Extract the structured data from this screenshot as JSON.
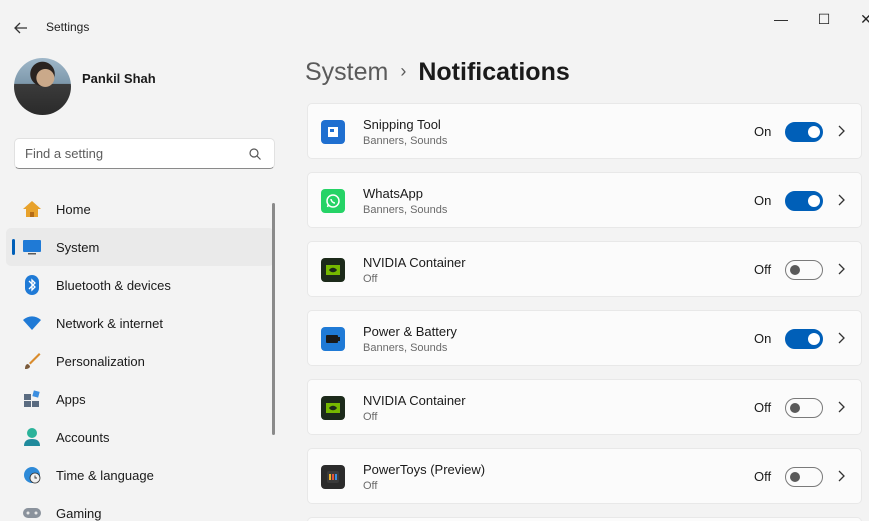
{
  "window": {
    "title": "Settings",
    "back_icon": "arrow-left-icon",
    "minimize_glyph": "—",
    "maximize_glyph": "☐",
    "close_glyph": "✕"
  },
  "profile": {
    "name": "Pankil Shah"
  },
  "search": {
    "placeholder": "Find a setting"
  },
  "sidebar": {
    "items": [
      {
        "label": "Home",
        "icon": "home-icon",
        "active": false
      },
      {
        "label": "System",
        "icon": "system-monitor-icon",
        "active": true
      },
      {
        "label": "Bluetooth & devices",
        "icon": "bluetooth-icon",
        "active": false
      },
      {
        "label": "Network & internet",
        "icon": "wifi-icon",
        "active": false
      },
      {
        "label": "Personalization",
        "icon": "brush-icon",
        "active": false
      },
      {
        "label": "Apps",
        "icon": "apps-icon",
        "active": false
      },
      {
        "label": "Accounts",
        "icon": "accounts-icon",
        "active": false
      },
      {
        "label": "Time & language",
        "icon": "globe-clock-icon",
        "active": false
      },
      {
        "label": "Gaming",
        "icon": "gamepad-icon",
        "active": false
      }
    ]
  },
  "header": {
    "parent": "System",
    "separator": "›",
    "current": "Notifications"
  },
  "apps": [
    {
      "name": "Snipping Tool",
      "detail": "Banners, Sounds",
      "state": "On",
      "enabled": true,
      "icon": "snipping-tool-icon"
    },
    {
      "name": "WhatsApp",
      "detail": "Banners, Sounds",
      "state": "On",
      "enabled": true,
      "icon": "whatsapp-icon"
    },
    {
      "name": "NVIDIA Container",
      "detail": "Off",
      "state": "Off",
      "enabled": false,
      "icon": "nvidia-icon"
    },
    {
      "name": "Power & Battery",
      "detail": "Banners, Sounds",
      "state": "On",
      "enabled": true,
      "icon": "battery-icon"
    },
    {
      "name": "NVIDIA Container",
      "detail": "Off",
      "state": "Off",
      "enabled": false,
      "icon": "nvidia-icon"
    },
    {
      "name": "PowerToys (Preview)",
      "detail": "Off",
      "state": "Off",
      "enabled": false,
      "icon": "powertoys-icon"
    }
  ],
  "colors": {
    "accent": "#005fb8",
    "background": "#f3f3f3",
    "card": "#fbfbfb"
  }
}
